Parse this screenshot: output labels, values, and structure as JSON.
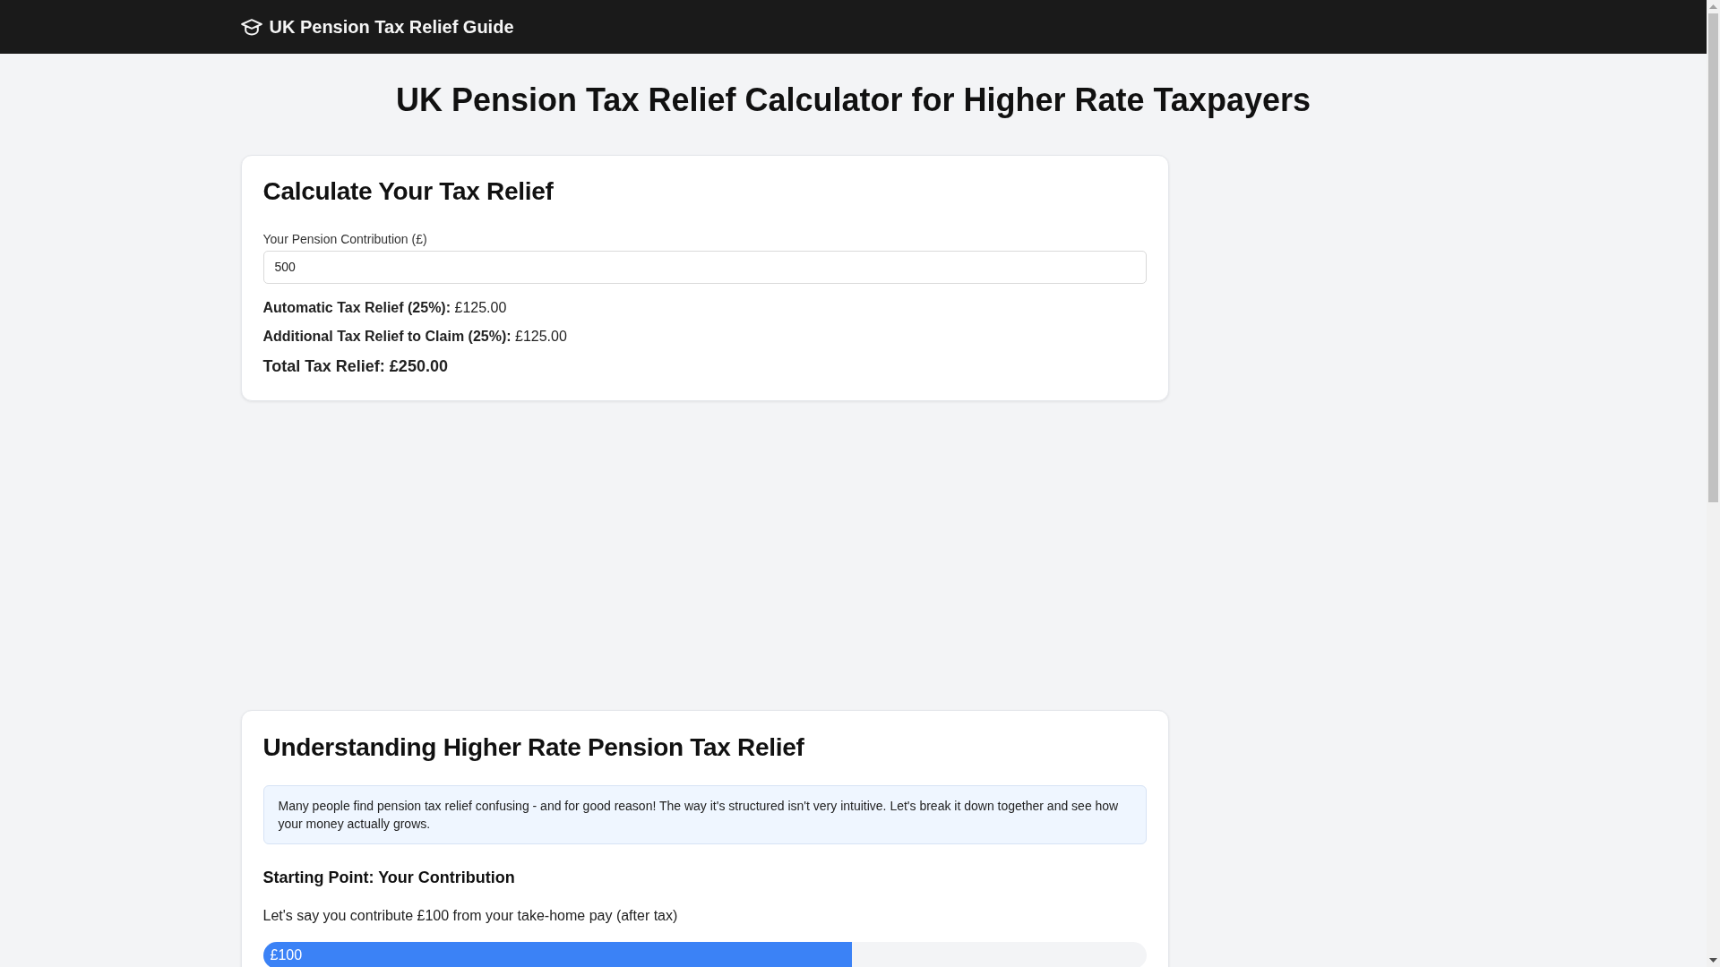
{
  "header": {
    "title": "UK Pension Tax Relief Guide"
  },
  "page_title": "UK Pension Tax Relief Calculator for Higher Rate Taxpayers",
  "calculator": {
    "heading": "Calculate Your Tax Relief",
    "contribution_field": {
      "label": "Your Pension Contribution (£)",
      "value": "500"
    },
    "results": [
      {
        "kind": "line",
        "text": "**Automatic Tax Relief (25%):** £125.00"
      },
      {
        "kind": "line",
        "text": "**Additional Tax Relief to Claim (25%):** £125.00"
      },
      {
        "kind": "total",
        "text": "Total Tax Relief: £250.00"
      }
    ]
  },
  "explainer": {
    "heading": "Understanding Higher Rate Pension Tax Relief",
    "intro": "Many people find pension tax relief confusing - and for good reason! The way it's structured isn't very intuitive. Let's break it down together and see how your money actually grows.",
    "sections": [
      {
        "heading": "Starting Point: Your Contribution",
        "text": "Let's say you contribute £100 from your take-home pay (after tax)",
        "bar": {
          "label": "£100",
          "level": 0.667
        }
      }
    ]
  }
}
